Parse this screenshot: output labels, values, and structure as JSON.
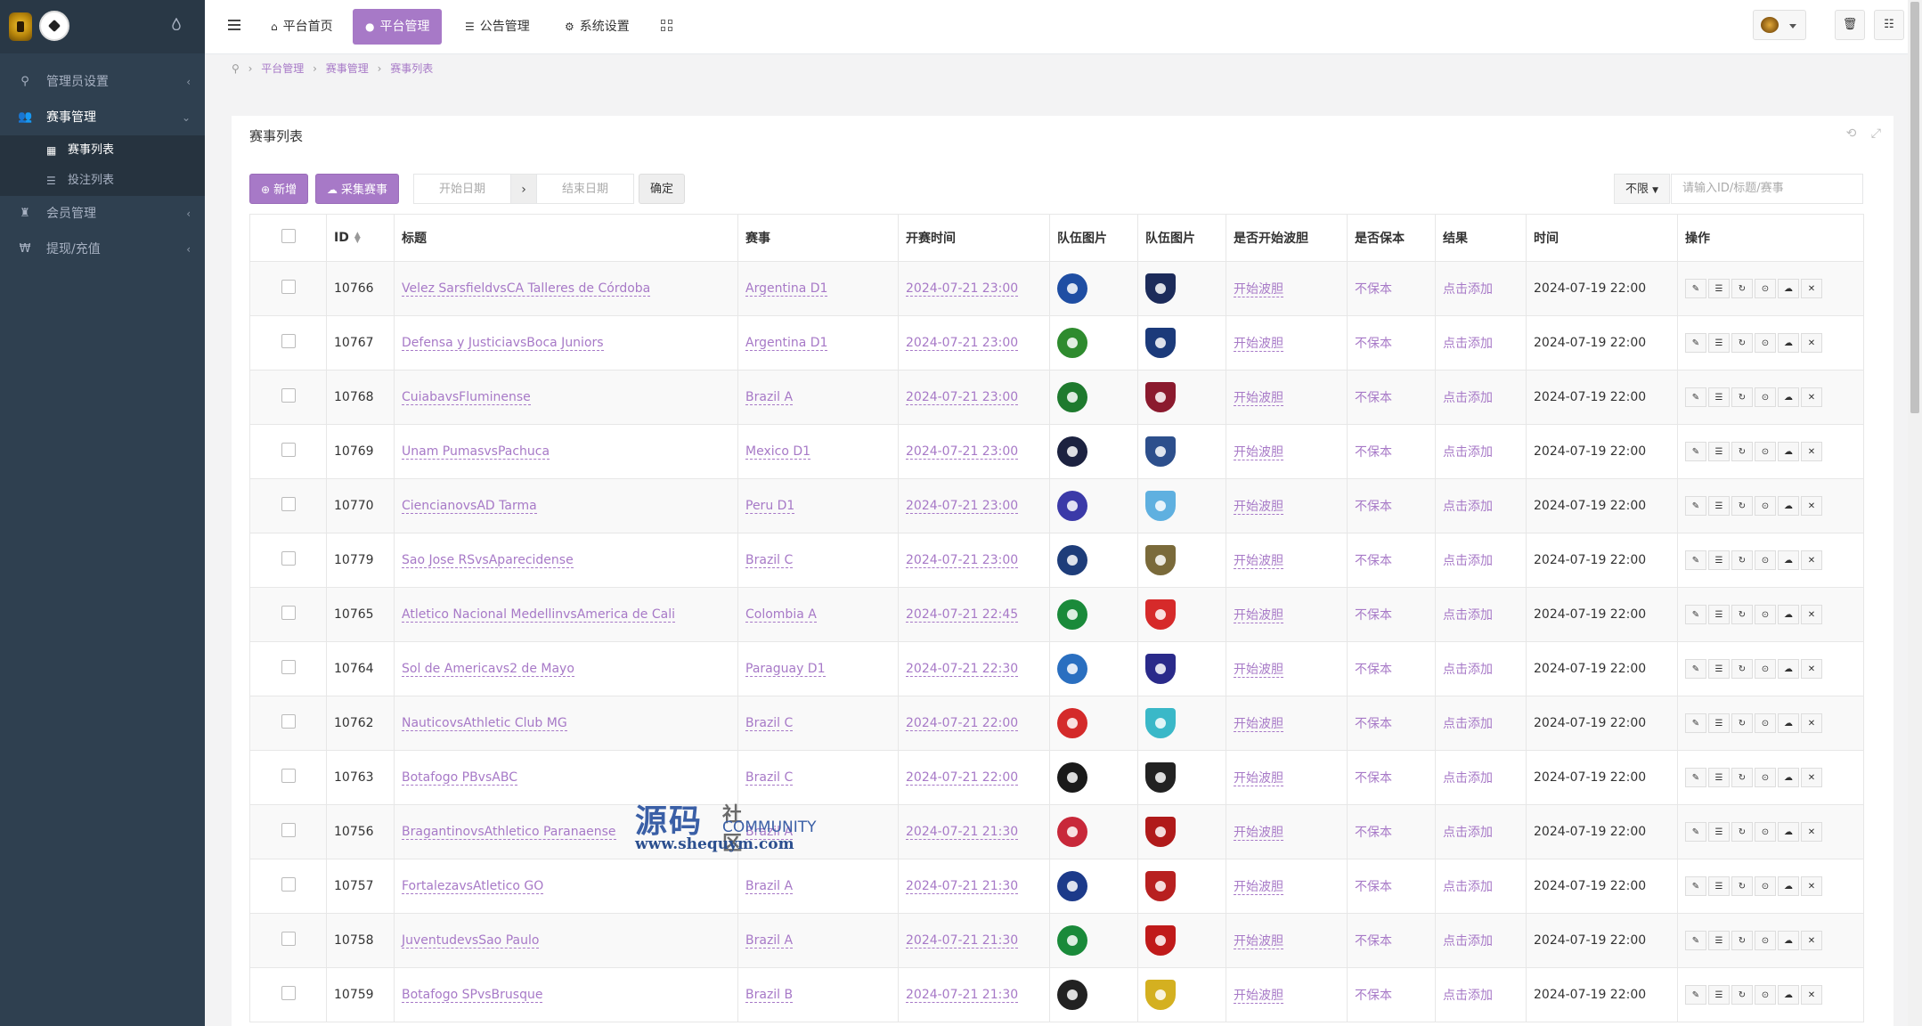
{
  "sidebar": {
    "items": [
      {
        "label": "管理员设置",
        "icon": "key-icon"
      },
      {
        "label": "赛事管理",
        "icon": "users-icon",
        "children": [
          {
            "label": "赛事列表",
            "icon": "table-icon"
          },
          {
            "label": "投注列表",
            "icon": "list-icon"
          }
        ]
      },
      {
        "label": "会员管理",
        "icon": "trophy-icon"
      },
      {
        "label": "提现/充值",
        "icon": "won-icon"
      }
    ]
  },
  "header": {
    "tabs": [
      {
        "label": "平台首页",
        "icon": "home-icon"
      },
      {
        "label": "平台管理",
        "icon": "user-icon"
      },
      {
        "label": "公告管理",
        "icon": "list-icon"
      },
      {
        "label": "系统设置",
        "icon": "gear-icon"
      }
    ]
  },
  "breadcrumb": [
    "平台管理",
    "赛事管理",
    "赛事列表"
  ],
  "panel": {
    "title": "赛事列表",
    "add_label": "新增",
    "collect_label": "采集赛事",
    "start_date_placeholder": "开始日期",
    "end_date_placeholder": "结束日期",
    "confirm_label": "确定",
    "filter_value": "不限",
    "search_placeholder": "请输入ID/标题/赛事"
  },
  "table": {
    "headers": [
      "ID",
      "标题",
      "赛事",
      "开赛时间",
      "队伍图片",
      "队伍图片",
      "是否开始波胆",
      "是否保本",
      "结果",
      "时间",
      "操作"
    ],
    "rows": [
      {
        "id": "10766",
        "title": "Velez SarsfieldvsCA Talleres de Córdoba",
        "league": "Argentina D1",
        "start": "2024-07-21 23:00",
        "bodan": "开始波胆",
        "baoben": "不保本",
        "result": "点击添加",
        "time": "2024-07-19 22:00",
        "c1": "#1f4ea3",
        "c2": "#1c2b5a"
      },
      {
        "id": "10767",
        "title": "Defensa y JusticiavsBoca Juniors",
        "league": "Argentina D1",
        "start": "2024-07-21 23:00",
        "bodan": "开始波胆",
        "baoben": "不保本",
        "result": "点击添加",
        "time": "2024-07-19 22:00",
        "c1": "#2e8b2e",
        "c2": "#1b3a7a"
      },
      {
        "id": "10768",
        "title": "CuiabavsFluminense",
        "league": "Brazil A",
        "start": "2024-07-21 23:00",
        "bodan": "开始波胆",
        "baoben": "不保本",
        "result": "点击添加",
        "time": "2024-07-19 22:00",
        "c1": "#1e7a2e",
        "c2": "#8b1a2e"
      },
      {
        "id": "10769",
        "title": "Unam PumasvsPachuca",
        "league": "Mexico D1",
        "start": "2024-07-21 23:00",
        "bodan": "开始波胆",
        "baoben": "不保本",
        "result": "点击添加",
        "time": "2024-07-19 22:00",
        "c1": "#1c2240",
        "c2": "#2d4f8c"
      },
      {
        "id": "10770",
        "title": "CiencianovsAD Tarma",
        "league": "Peru D1",
        "start": "2024-07-21 23:00",
        "bodan": "开始波胆",
        "baoben": "不保本",
        "result": "点击添加",
        "time": "2024-07-19 22:00",
        "c1": "#3b3aa8",
        "c2": "#5fb0e0"
      },
      {
        "id": "10779",
        "title": "Sao Jose RSvsAparecidense",
        "league": "Brazil C",
        "start": "2024-07-21 23:00",
        "bodan": "开始波胆",
        "baoben": "不保本",
        "result": "点击添加",
        "time": "2024-07-19 22:00",
        "c1": "#1e3d7a",
        "c2": "#7a6a3a"
      },
      {
        "id": "10765",
        "title": "Atletico Nacional MedellinvsAmerica de Cali",
        "league": "Colombia A",
        "start": "2024-07-21 22:45",
        "bodan": "开始波胆",
        "baoben": "不保本",
        "result": "点击添加",
        "time": "2024-07-19 22:00",
        "c1": "#1a8a3a",
        "c2": "#d62a2a"
      },
      {
        "id": "10764",
        "title": "Sol de Americavs2 de Mayo",
        "league": "Paraguay D1",
        "start": "2024-07-21 22:30",
        "bodan": "开始波胆",
        "baoben": "不保本",
        "result": "点击添加",
        "time": "2024-07-19 22:00",
        "c1": "#2a6fc0",
        "c2": "#2a2a8a"
      },
      {
        "id": "10762",
        "title": "NauticovsAthletic Club MG",
        "league": "Brazil C",
        "start": "2024-07-21 22:00",
        "bodan": "开始波胆",
        "baoben": "不保本",
        "result": "点击添加",
        "time": "2024-07-19 22:00",
        "c1": "#d42a2a",
        "c2": "#3ab8c8"
      },
      {
        "id": "10763",
        "title": "Botafogo PBvsABC",
        "league": "Brazil C",
        "start": "2024-07-21 22:00",
        "bodan": "开始波胆",
        "baoben": "不保本",
        "result": "点击添加",
        "time": "2024-07-19 22:00",
        "c1": "#1a1a1a",
        "c2": "#222222"
      },
      {
        "id": "10756",
        "title": "BragantinovsAthletico Paranaense",
        "league": "Brazil A",
        "start": "2024-07-21 21:30",
        "bodan": "开始波胆",
        "baoben": "不保本",
        "result": "点击添加",
        "time": "2024-07-19 22:00",
        "c1": "#c8283a",
        "c2": "#b01a1a"
      },
      {
        "id": "10757",
        "title": "FortalezavsAtletico GO",
        "league": "Brazil A",
        "start": "2024-07-21 21:30",
        "bodan": "开始波胆",
        "baoben": "不保本",
        "result": "点击添加",
        "time": "2024-07-19 22:00",
        "c1": "#1c3a8a",
        "c2": "#b82020"
      },
      {
        "id": "10758",
        "title": "JuventudevsSao Paulo",
        "league": "Brazil A",
        "start": "2024-07-21 21:30",
        "bodan": "开始波胆",
        "baoben": "不保本",
        "result": "点击添加",
        "time": "2024-07-19 22:00",
        "c1": "#1a8a3a",
        "c2": "#c01a1a"
      },
      {
        "id": "10759",
        "title": "Botafogo SPvsBrusque",
        "league": "Brazil B",
        "start": "2024-07-21 21:30",
        "bodan": "开始波胆",
        "baoben": "不保本",
        "result": "点击添加",
        "time": "2024-07-19 22:00",
        "c1": "#222222",
        "c2": "#d4b020"
      }
    ]
  },
  "watermark": {
    "cn": "源码",
    "cn2": "社区",
    "en": "COMMUNITY",
    "url": "www.shequym.com"
  },
  "colors": {
    "accent": "#a779c7",
    "sidebar": "#2f4050"
  }
}
